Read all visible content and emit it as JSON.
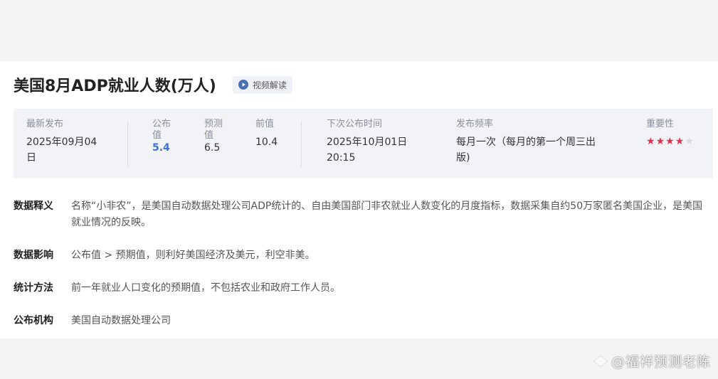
{
  "header": {
    "title": "美国8月ADP就业人数(万人)",
    "video_label": "视频解读",
    "video_icon": "play-circle-icon"
  },
  "stats": {
    "latest_release": {
      "label": "最新发布",
      "value": "2025年09月04\n日"
    },
    "actual": {
      "label": "公布\n值",
      "value": "5.4"
    },
    "forecast": {
      "label": "预测\n值",
      "value": "6.5"
    },
    "previous": {
      "label": "前值",
      "value": "10.4"
    },
    "next_release": {
      "label": "下次公布时间",
      "value": "2025年10月01日\n20:15"
    },
    "frequency": {
      "label": "发布频率",
      "value": "每月一次（每月的第一个周三出\n版)"
    },
    "importance": {
      "label": "重要性",
      "rating": 4,
      "max": 5
    }
  },
  "info": [
    {
      "key": "数据释义",
      "value": "名称“小非农”，是美国自动数据处理公司ADP统计的、自由美国部门非农就业人数变化的月度指标，数据采集自约50万家匿名美国企业，是美国就业情况的反映。"
    },
    {
      "key": "数据影响",
      "value": "公布值 > 预期值，则利好美国经济及美元，利空非美。"
    },
    {
      "key": "统计方法",
      "value": "前一年就业人口变化的预期值，不包括农业和政府工作人员。"
    },
    {
      "key": "公布机构",
      "value": "美国自动数据处理公司"
    }
  ],
  "watermark": {
    "text": "@福祥预测老陈"
  },
  "colors": {
    "accent_blue": "#3b72d6",
    "star_red": "#e0314b",
    "panel_bg": "#f1f3f6"
  }
}
